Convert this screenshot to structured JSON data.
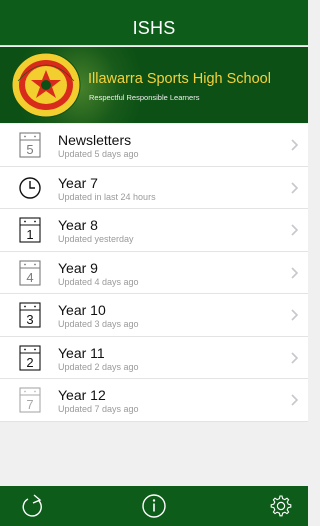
{
  "header": {
    "title": "ISHS"
  },
  "banner": {
    "school_name": "Illawarra Sports High School",
    "motto": "Respectful Responsible Learners",
    "crest_text_top": "Illawarra",
    "crest_text_bottom": "Sports High School"
  },
  "rows": [
    {
      "title": "Newsletters",
      "subtitle": "Updated 5 days ago",
      "icon": "calendar-icon",
      "number": "5",
      "style": "gray"
    },
    {
      "title": "Year 7",
      "subtitle": "Updated in last 24 hours",
      "icon": "clock-icon",
      "number": "",
      "style": "dark"
    },
    {
      "title": "Year 8",
      "subtitle": "Updated yesterday",
      "icon": "calendar-icon",
      "number": "1",
      "style": "dark"
    },
    {
      "title": "Year 9",
      "subtitle": "Updated 4 days ago",
      "icon": "calendar-icon",
      "number": "4",
      "style": "gray"
    },
    {
      "title": "Year 10",
      "subtitle": "Updated 3 days ago",
      "icon": "calendar-icon",
      "number": "3",
      "style": "dark"
    },
    {
      "title": "Year 11",
      "subtitle": "Updated 2 days ago",
      "icon": "calendar-icon",
      "number": "2",
      "style": "dark"
    },
    {
      "title": "Year 12",
      "subtitle": "Updated 7 days ago",
      "icon": "calendar-icon",
      "number": "7",
      "style": "light"
    }
  ],
  "footer": {
    "icons": [
      "refresh-icon",
      "info-icon",
      "settings-gear-icon"
    ]
  },
  "colors": {
    "brand_green": "#0e5c1a",
    "school_name_gold": "#f4d23c",
    "chevron_gray": "#c7c7cc"
  }
}
